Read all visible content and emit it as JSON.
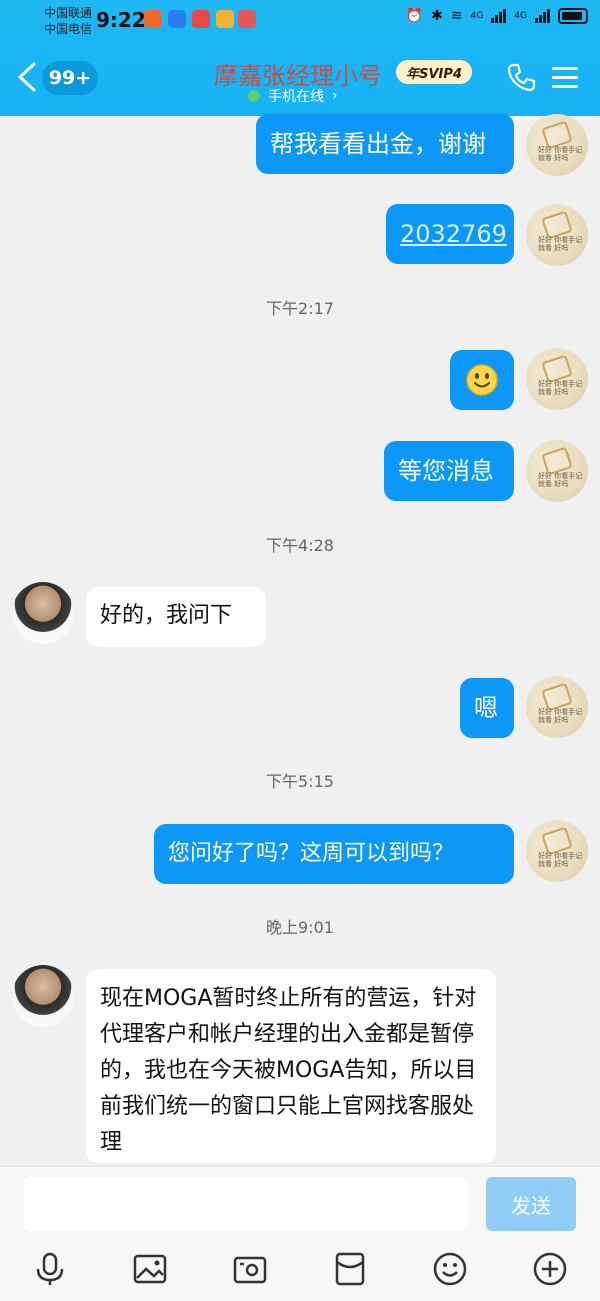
{
  "status_bar": {
    "carrier1": "中国联通",
    "carrier2": "中国电信",
    "time": "9:22",
    "net1": "4G",
    "net2": "4G"
  },
  "header": {
    "unread_badge": "99+",
    "title": "摩嘉张经理小号",
    "svip_badge": "年SVIP4",
    "status": "手机在线",
    "status_chevron": "›"
  },
  "messages": [
    {
      "side": "self",
      "type": "text",
      "text": "帮我看看出金，谢谢"
    },
    {
      "side": "self",
      "type": "link",
      "text": "2032769"
    },
    {
      "type": "timestamp",
      "text": "下午2:17"
    },
    {
      "side": "self",
      "type": "emoji",
      "text": "smile-emoji"
    },
    {
      "side": "self",
      "type": "text",
      "text": "等您消息"
    },
    {
      "type": "timestamp",
      "text": "下午4:28"
    },
    {
      "side": "other",
      "type": "text",
      "text": "好的，我问下"
    },
    {
      "side": "self",
      "type": "text",
      "text": "嗯"
    },
    {
      "type": "timestamp",
      "text": "下午5:15"
    },
    {
      "side": "self",
      "type": "text",
      "text": "您问好了吗？这周可以到吗？"
    },
    {
      "type": "timestamp",
      "text": "晚上9:01"
    },
    {
      "side": "other",
      "type": "text",
      "text": "现在MOGA暂时终止所有的营运，针对代理客户和帐户经理的出入金都是暂停的，我也在今天被MOGA告知，所以目前我们统一的窗口只能上官网找客服处理"
    }
  ],
  "composer": {
    "send_label": "发送"
  },
  "toolbar_icons": [
    "microphone-icon",
    "image-icon",
    "camera-icon",
    "red-packet-icon",
    "emoji-icon",
    "plus-icon"
  ],
  "colors": {
    "header_bg": "#16b2f2",
    "self_bubble": "#0d97f7",
    "send_disabled": "#8fcdf7",
    "title_text": "#c44e49"
  }
}
